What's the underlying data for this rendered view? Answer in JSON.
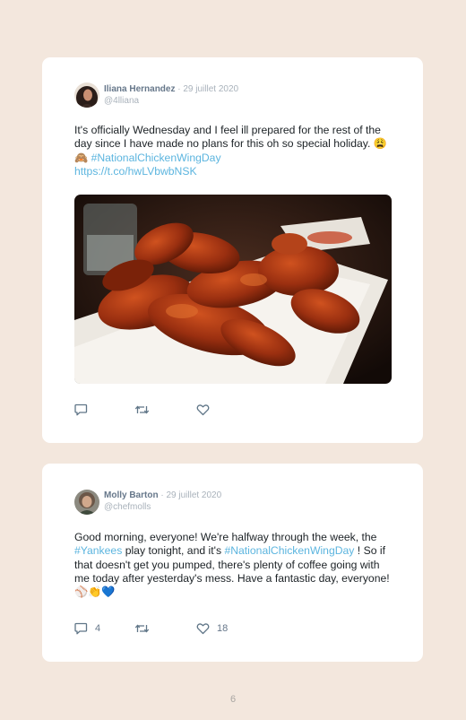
{
  "tweets": [
    {
      "name": "Iliana Hernandez",
      "separator": "·",
      "date": "29 juillet 2020",
      "handle": "@4lliana",
      "text_plain": "It's officially Wednesday and I feel ill prepared for the rest of the day since I have made no plans for this oh so special holiday. ",
      "emoji": "😩🙈",
      "hashtag": "#NationalChickenWingDay",
      "url": "https://t.co/hwLVbwbNSK",
      "image_description": "chicken-wings-photo",
      "replies": "",
      "retweets": "",
      "likes": ""
    },
    {
      "name": "Molly Barton",
      "separator": "·",
      "date": "29 juillet 2020",
      "handle": "@chefmolls",
      "text_a": "Good morning, everyone! We're halfway through the week, the ",
      "hashtag_a": "#Yankees",
      "text_b": " play tonight, and it's ",
      "hashtag_b": "#NationalChickenWingDay",
      "text_c": " ! So if that doesn't get you pumped, there's plenty of coffee going with me today after yesterday's mess. Have a fantastic day, everyone! ",
      "emoji": "⚾👏💙",
      "replies": "4",
      "retweets": "",
      "likes": "18"
    }
  ],
  "page_number": "6",
  "colors": {
    "background": "#f3e7dd",
    "card": "#ffffff",
    "link": "#5cb5df",
    "icon": "#5f7587",
    "name": "#66778a"
  },
  "icons": [
    "reply-icon",
    "retweet-icon",
    "like-icon"
  ]
}
